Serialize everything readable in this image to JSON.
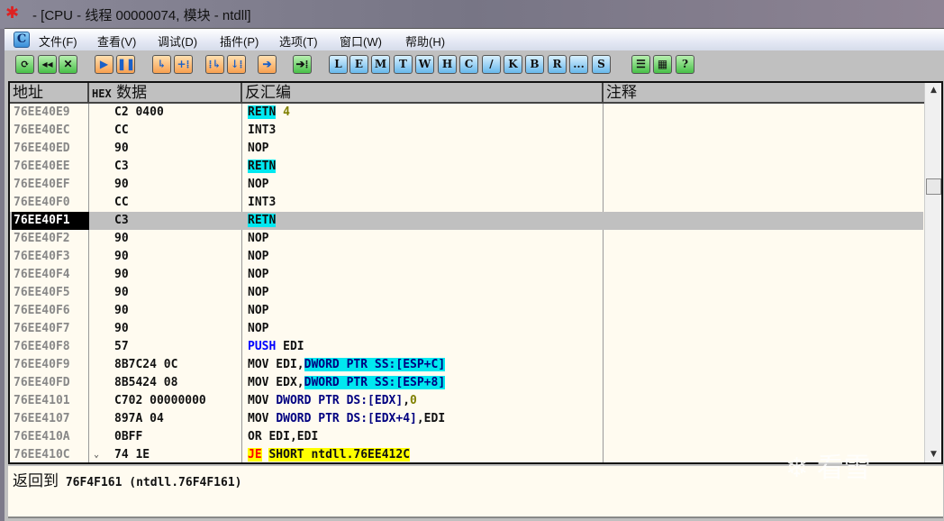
{
  "title": " - [CPU - 线程 00000074, 模块 - ntdll]",
  "menu": [
    "文件(F)",
    "查看(V)",
    "调试(D)",
    "插件(P)",
    "选项(T)",
    "窗口(W)",
    "帮助(H)"
  ],
  "menu_logo": "C",
  "toolbar": [
    {
      "l": "⟳",
      "k": "g",
      "n": "open-icon"
    },
    {
      "l": "◂◂",
      "k": "g",
      "n": "restart-icon"
    },
    {
      "l": "✕",
      "k": "g",
      "n": "close-icon"
    },
    {
      "l": "▶",
      "k": "o",
      "n": "run-icon"
    },
    {
      "l": "❚❚",
      "k": "o",
      "n": "pause-icon"
    },
    {
      "l": "↳",
      "k": "o",
      "n": "step-into-icon"
    },
    {
      "l": "+⁞",
      "k": "o",
      "n": "step-over-icon"
    },
    {
      "l": "⁞↳",
      "k": "o",
      "n": "trace-into-icon"
    },
    {
      "l": "↓⁞",
      "k": "o",
      "n": "trace-over-icon"
    },
    {
      "l": "➔",
      "k": "o",
      "n": "execute-till-return-icon"
    },
    {
      "l": "➔⁞",
      "k": "g",
      "n": "goto-icon"
    },
    {
      "l": "L",
      "k": "b",
      "n": "log-icon"
    },
    {
      "l": "E",
      "k": "b",
      "n": "executables-icon"
    },
    {
      "l": "M",
      "k": "b",
      "n": "memory-icon"
    },
    {
      "l": "T",
      "k": "b",
      "n": "threads-icon"
    },
    {
      "l": "W",
      "k": "b",
      "n": "windows-icon"
    },
    {
      "l": "H",
      "k": "b",
      "n": "handles-icon"
    },
    {
      "l": "C",
      "k": "b",
      "n": "cpu-icon"
    },
    {
      "l": "/",
      "k": "b",
      "n": "patches-icon"
    },
    {
      "l": "K",
      "k": "b",
      "n": "callstack-icon"
    },
    {
      "l": "B",
      "k": "b",
      "n": "breakpoints-icon"
    },
    {
      "l": "R",
      "k": "b",
      "n": "references-icon"
    },
    {
      "l": "...",
      "k": "b",
      "n": "run-trace-icon"
    },
    {
      "l": "S",
      "k": "b",
      "n": "source-icon"
    },
    {
      "l": "☰",
      "k": "g",
      "n": "list-icon"
    },
    {
      "l": "▦",
      "k": "g",
      "n": "colors-icon"
    },
    {
      "l": "?",
      "k": "g",
      "n": "help-icon"
    }
  ],
  "headers": {
    "addr": "地址",
    "hex_prefix": "HEX",
    "hex": " 数据",
    "dis": "反汇编",
    "comment": "注释"
  },
  "colors": {
    "cyan": "#00e8f0",
    "yellow": "#ffff00",
    "blue": "#0000ff",
    "navy": "#000080",
    "red": "#ff0000",
    "olive": "#808000"
  },
  "rows": [
    {
      "a": "76EE40E9",
      "h": "C2 0400",
      "d": [
        {
          "t": "RETN",
          "bg": "cyan"
        },
        {
          "t": " "
        },
        {
          "t": "4",
          "c": "olive"
        }
      ]
    },
    {
      "a": "76EE40EC",
      "h": "CC",
      "d": [
        {
          "t": "INT3"
        }
      ]
    },
    {
      "a": "76EE40ED",
      "h": "90",
      "d": [
        {
          "t": "NOP"
        }
      ]
    },
    {
      "a": "76EE40EE",
      "h": "C3",
      "d": [
        {
          "t": "RETN",
          "bg": "cyan"
        }
      ]
    },
    {
      "a": "76EE40EF",
      "h": "90",
      "d": [
        {
          "t": "NOP"
        }
      ]
    },
    {
      "a": "76EE40F0",
      "h": "CC",
      "d": [
        {
          "t": "INT3"
        }
      ]
    },
    {
      "a": "76EE40F1",
      "h": "C3",
      "d": [
        {
          "t": "RETN",
          "bg": "cyan"
        }
      ],
      "sel": true
    },
    {
      "a": "76EE40F2",
      "h": "90",
      "d": [
        {
          "t": "NOP"
        }
      ]
    },
    {
      "a": "76EE40F3",
      "h": "90",
      "d": [
        {
          "t": "NOP"
        }
      ]
    },
    {
      "a": "76EE40F4",
      "h": "90",
      "d": [
        {
          "t": "NOP"
        }
      ]
    },
    {
      "a": "76EE40F5",
      "h": "90",
      "d": [
        {
          "t": "NOP"
        }
      ]
    },
    {
      "a": "76EE40F6",
      "h": "90",
      "d": [
        {
          "t": "NOP"
        }
      ]
    },
    {
      "a": "76EE40F7",
      "h": "90",
      "d": [
        {
          "t": "NOP"
        }
      ]
    },
    {
      "a": "76EE40F8",
      "h": "57",
      "d": [
        {
          "t": "PUSH",
          "c": "blue"
        },
        {
          "t": " EDI"
        }
      ]
    },
    {
      "a": "76EE40F9",
      "h": "8B7C24 0C",
      "d": [
        {
          "t": "MOV EDI,"
        },
        {
          "t": "DWORD PTR SS:[ESP+C]",
          "c": "navy",
          "bg": "cyan"
        }
      ]
    },
    {
      "a": "76EE40FD",
      "h": "8B5424 08",
      "d": [
        {
          "t": "MOV EDX,"
        },
        {
          "t": "DWORD PTR SS:[ESP+8]",
          "c": "navy",
          "bg": "cyan"
        }
      ]
    },
    {
      "a": "76EE4101",
      "h": "C702 00000000",
      "d": [
        {
          "t": "MOV "
        },
        {
          "t": "DWORD PTR DS:[EDX]",
          "c": "navy"
        },
        {
          "t": ","
        },
        {
          "t": "0",
          "c": "olive"
        }
      ]
    },
    {
      "a": "76EE4107",
      "h": "897A 04",
      "d": [
        {
          "t": "MOV "
        },
        {
          "t": "DWORD PTR DS:[EDX+4]",
          "c": "navy"
        },
        {
          "t": ",EDI"
        }
      ]
    },
    {
      "a": "76EE410A",
      "h": "0BFF",
      "d": [
        {
          "t": "OR EDI,EDI"
        }
      ]
    },
    {
      "a": "76EE410C",
      "h": "74 1E",
      "d": [
        {
          "t": "JE",
          "c": "red",
          "bg": "yellow"
        },
        {
          "t": " "
        },
        {
          "t": "SHORT ntdll.76EE412C",
          "bg": "yellow"
        }
      ],
      "jump": true
    }
  ],
  "info": {
    "label": "返回到",
    "value": " 76F4F161 (ntdll.76F4F161)"
  },
  "watermark": "看雪"
}
